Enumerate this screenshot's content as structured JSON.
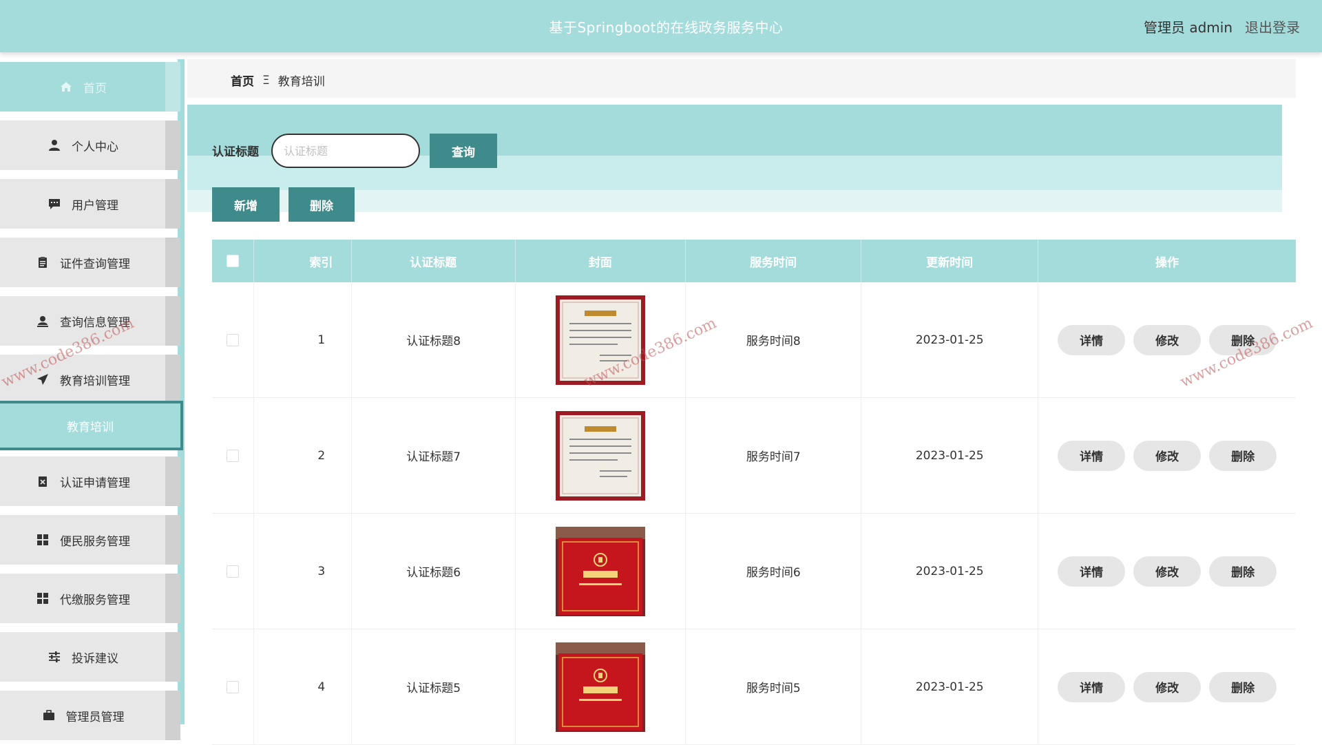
{
  "header": {
    "title": "基于Springboot的在线政务服务中心",
    "user": "管理员 admin",
    "logout": "退出登录"
  },
  "sidebar": {
    "items": [
      {
        "label": "首页",
        "icon": "home-icon"
      },
      {
        "label": "个人中心",
        "icon": "user-icon"
      },
      {
        "label": "用户管理",
        "icon": "chat-icon"
      },
      {
        "label": "证件查询管理",
        "icon": "clipboard-icon"
      },
      {
        "label": "查询信息管理",
        "icon": "user-card-icon"
      },
      {
        "label": "教育培训管理",
        "icon": "send-icon"
      },
      {
        "label": "认证申请管理",
        "icon": "checklist-icon"
      },
      {
        "label": "便民服务管理",
        "icon": "grid-icon"
      },
      {
        "label": "代缴服务管理",
        "icon": "grid-icon"
      },
      {
        "label": "投诉建议",
        "icon": "sliders-icon"
      },
      {
        "label": "管理员管理",
        "icon": "briefcase-icon"
      }
    ],
    "active_sub": "教育培训"
  },
  "breadcrumb": {
    "home": "首页",
    "separator": "Ξ",
    "current": "教育培训"
  },
  "search": {
    "label": "认证标题",
    "placeholder": "认证标题",
    "value": "",
    "query_button": "查询"
  },
  "actions": {
    "add": "新增",
    "delete": "删除"
  },
  "table": {
    "columns": [
      "索引",
      "认证标题",
      "封面",
      "服务时间",
      "更新时间",
      "操作"
    ],
    "rows": [
      {
        "index": "1",
        "title": "认证标题8",
        "cover": "certificate-image",
        "service_time": "服务时间8",
        "updated": "2023-01-25"
      },
      {
        "index": "2",
        "title": "认证标题7",
        "cover": "certificate-image",
        "service_time": "服务时间7",
        "updated": "2023-01-25"
      },
      {
        "index": "3",
        "title": "认证标题6",
        "cover": "donation-certificate-image",
        "service_time": "服务时间6",
        "updated": "2023-01-25"
      },
      {
        "index": "4",
        "title": "认证标题5",
        "cover": "donation-certificate-image",
        "service_time": "服务时间5",
        "updated": "2023-01-25"
      }
    ],
    "row_actions": {
      "detail": "详情",
      "edit": "修改",
      "delete": "删除"
    }
  },
  "watermark": "www.code386.com",
  "colors": {
    "accent": "#a4dcdb",
    "button": "#3f8a8a",
    "op_button": "#e6e6e6"
  }
}
